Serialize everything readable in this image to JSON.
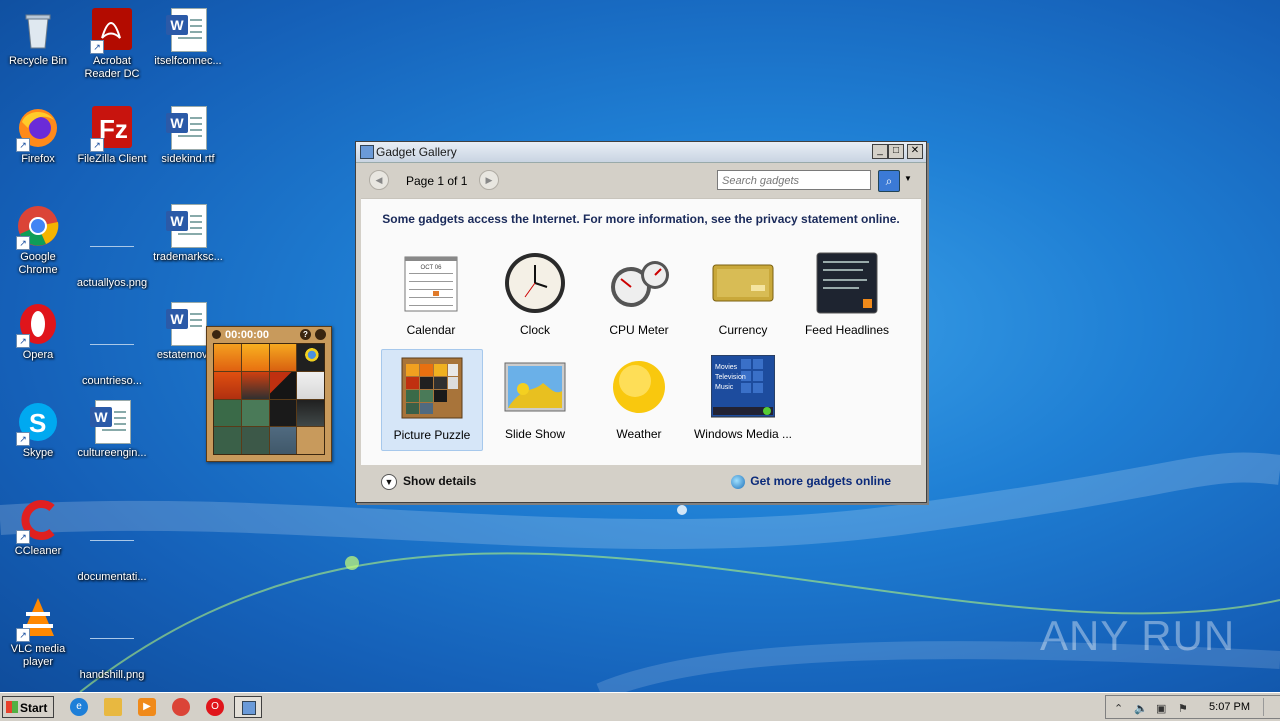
{
  "desktop": {
    "icons": [
      {
        "label": "Recycle Bin",
        "icon": "recycle-bin-icon"
      },
      {
        "label": "Acrobat Reader DC",
        "icon": "acrobat-icon"
      },
      {
        "label": "itselfconnec...",
        "icon": "word-doc-icon"
      },
      {
        "label": "Firefox",
        "icon": "firefox-icon"
      },
      {
        "label": "FileZilla Client",
        "icon": "filezilla-icon"
      },
      {
        "label": "sidekind.rtf",
        "icon": "word-doc-icon"
      },
      {
        "label": "Google Chrome",
        "icon": "chrome-icon"
      },
      {
        "label": "actuallyos.png",
        "icon": "image-file-icon"
      },
      {
        "label": "trademarksc...",
        "icon": "word-doc-icon"
      },
      {
        "label": "Opera",
        "icon": "opera-icon"
      },
      {
        "label": "countrieso...",
        "icon": "image-file-icon"
      },
      {
        "label": "estatemovi...",
        "icon": "word-doc-icon"
      },
      {
        "label": "Skype",
        "icon": "skype-icon"
      },
      {
        "label": "cultureengin...",
        "icon": "word-doc-icon"
      },
      {
        "label": "CCleaner",
        "icon": "ccleaner-icon"
      },
      {
        "label": "documentati...",
        "icon": "image-file-icon"
      },
      {
        "label": "VLC media player",
        "icon": "vlc-icon"
      },
      {
        "label": "handshill.png",
        "icon": "image-file-icon"
      }
    ]
  },
  "puzzle_gadget": {
    "timer": "00:00:00"
  },
  "gallery": {
    "title": "Gadget Gallery",
    "page_text": "Page 1 of 1",
    "search_placeholder": "Search gadgets",
    "notice": "Some gadgets access the Internet.  For more information, see the privacy statement online.",
    "gadgets": [
      {
        "label": "Calendar",
        "icon": "calendar-icon"
      },
      {
        "label": "Clock",
        "icon": "clock-icon"
      },
      {
        "label": "CPU Meter",
        "icon": "cpu-meter-icon"
      },
      {
        "label": "Currency",
        "icon": "currency-icon"
      },
      {
        "label": "Feed Headlines",
        "icon": "feed-headlines-icon"
      },
      {
        "label": "Picture Puzzle",
        "icon": "picture-puzzle-icon",
        "selected": true
      },
      {
        "label": "Slide Show",
        "icon": "slide-show-icon"
      },
      {
        "label": "Weather",
        "icon": "weather-icon"
      },
      {
        "label": "Windows Media ...",
        "icon": "windows-media-icon"
      }
    ],
    "calendar_month": "OCT 06",
    "media_lines": [
      "Movies",
      "Television",
      "Music"
    ],
    "show_details": "Show details",
    "get_more": "Get more gadgets online"
  },
  "taskbar": {
    "start_label": "Start",
    "clock": "5:07 PM"
  },
  "watermark": "ANY RUN"
}
